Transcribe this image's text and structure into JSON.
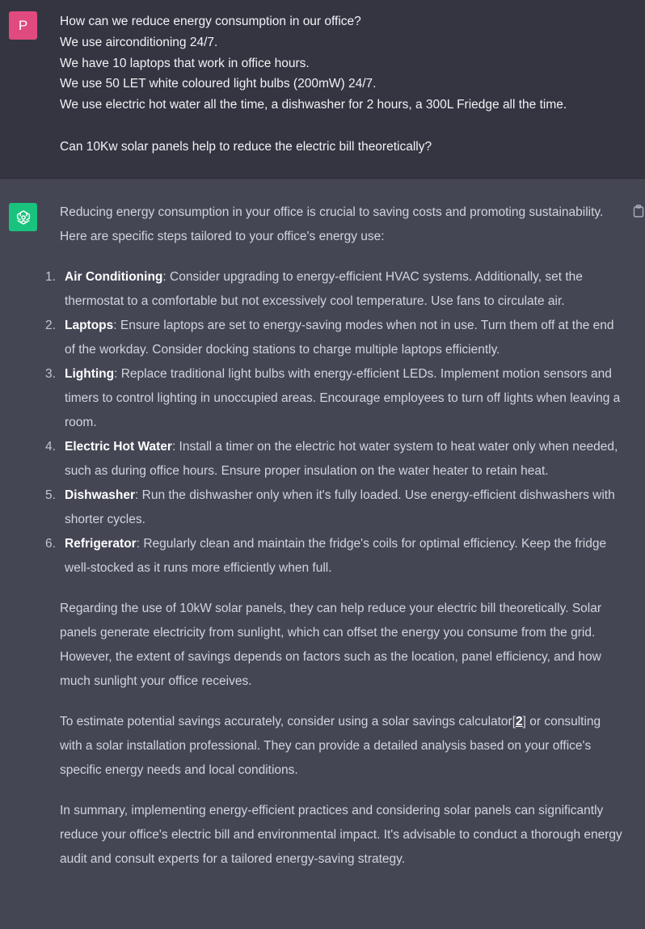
{
  "user": {
    "avatar_letter": "P",
    "lines": [
      "How can we reduce energy consumption in our office?",
      "We use airconditioning 24/7.",
      "We have 10 laptops that work in office hours.",
      "We use 50 LET white coloured light bulbs (200mW) 24/7.",
      "We use electric hot water all the time, a dishwasher for 2 hours, a 300L Friedge all the time.",
      "Can 10Kw solar panels help to reduce the electric bill theoretically?"
    ]
  },
  "assistant": {
    "avatar_icon": "openai-logo-icon",
    "copy_icon": "clipboard-icon",
    "intro": "Reducing energy consumption in your office is crucial to saving costs and promoting sustainability. Here are specific steps tailored to your office's energy use:",
    "items": [
      {
        "num": "1.",
        "title": "Air Conditioning",
        "text": ": Consider upgrading to energy-efficient HVAC systems. Additionally, set the thermostat to a comfortable but not excessively cool temperature. Use fans to circulate air."
      },
      {
        "num": "2.",
        "title": "Laptops",
        "text": ": Ensure laptops are set to energy-saving modes when not in use. Turn them off at the end of the workday. Consider docking stations to charge multiple laptops efficiently."
      },
      {
        "num": "3.",
        "title": "Lighting",
        "text": ": Replace traditional light bulbs with energy-efficient LEDs. Implement motion sensors and timers to control lighting in unoccupied areas. Encourage employees to turn off lights when leaving a room."
      },
      {
        "num": "4.",
        "title": "Electric Hot Water",
        "text": ": Install a timer on the electric hot water system to heat water only when needed, such as during office hours. Ensure proper insulation on the water heater to retain heat."
      },
      {
        "num": "5.",
        "title": "Dishwasher",
        "text": ": Run the dishwasher only when it's fully loaded. Use energy-efficient dishwashers with shorter cycles."
      },
      {
        "num": "6.",
        "title": "Refrigerator",
        "text": ": Regularly clean and maintain the fridge's coils for optimal efficiency. Keep the fridge well-stocked as it runs more efficiently when full."
      }
    ],
    "para_solar": "Regarding the use of 10kW solar panels, they can help reduce your electric bill theoretically. Solar panels generate electricity from sunlight, which can offset the energy you consume from the grid. However, the extent of savings depends on factors such as the location, panel efficiency, and how much sunlight your office receives.",
    "para_estimate_before": "To estimate potential savings accurately, consider using a solar savings calculator[",
    "citation": "2",
    "para_estimate_after": "] or consulting with a solar installation professional. They can provide a detailed analysis based on your office's specific energy needs and local conditions.",
    "para_summary": "In summary, implementing energy-efficient practices and considering solar panels can significantly reduce your office's electric bill and environmental impact. It's advisable to conduct a thorough energy audit and consult experts for a tailored energy-saving strategy."
  }
}
